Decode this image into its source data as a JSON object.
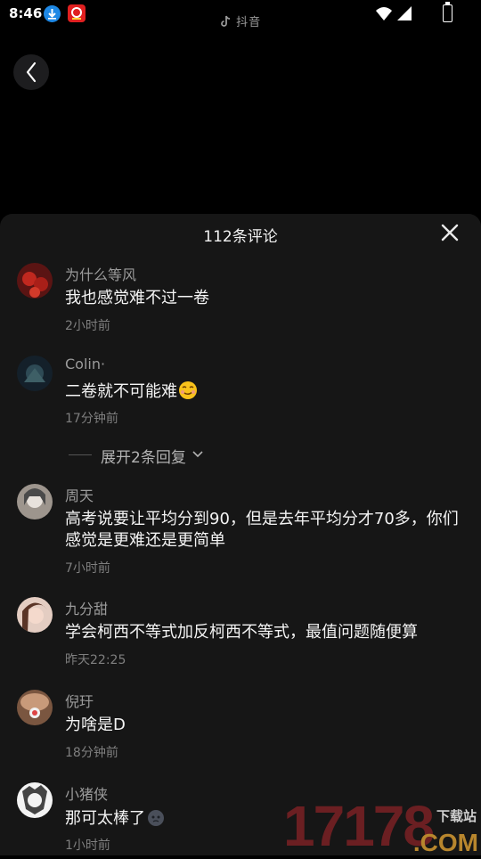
{
  "status_bar": {
    "time": "8:46",
    "watermark": "抖音"
  },
  "sheet": {
    "title": "112条评论",
    "expand_label": "展开2条回复"
  },
  "comments": [
    {
      "user": "为什么等风",
      "text": "我也感觉难不过一卷",
      "time": "2小时前",
      "avatar_color": "#8a1d1a"
    },
    {
      "user": "Colin·",
      "text": "二卷就不可能难",
      "time": "17分钟前",
      "avatar_color": "#1b2b33",
      "emoji": "smirk-emoji"
    },
    {
      "user": "周天",
      "text": "高考说要让平均分到90，但是去年平均分才70多，你们感觉是更难还是更简单",
      "time": "7小时前",
      "avatar_color": "#8d8781"
    },
    {
      "user": "九分甜",
      "text": "学会柯西不等式加反柯西不等式，最值问题随便算",
      "time": "昨天22:25",
      "avatar_color": "#d9b7a8"
    },
    {
      "user": "倪玗",
      "text": "为啥是D",
      "time": "18分钟前",
      "avatar_color": "#a8795e"
    },
    {
      "user": "小猪侠",
      "text": "那可太棒了",
      "time": "1小时前",
      "avatar_color": "#d8d8d8",
      "emoji": "dark-face-emoji"
    }
  ],
  "site_watermark": {
    "number": "17178",
    "label": "下载站",
    "domain": ".COM"
  },
  "colors": {
    "background": "#000000",
    "sheet": "#161616",
    "username": "#9b9b9b",
    "timestamp": "#7f7f7f"
  }
}
